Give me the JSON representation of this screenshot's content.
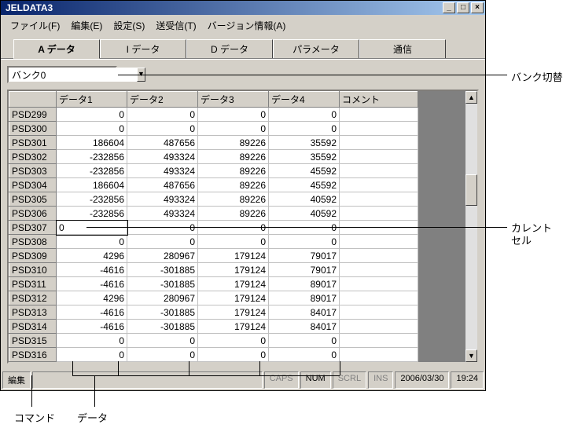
{
  "window": {
    "title": "JELDATA3"
  },
  "title_buttons": {
    "min": "_",
    "max": "□",
    "close": "×"
  },
  "menu": {
    "file": "ファイル(F)",
    "edit": "編集(E)",
    "settings": "設定(S)",
    "sendrecv": "送受信(T)",
    "version": "バージョン情報(A)"
  },
  "tabs": {
    "a": "A データ",
    "i": "I データ",
    "d": "D データ",
    "param": "パラメータ",
    "comm": "通信"
  },
  "bank": {
    "value": "バンク0"
  },
  "columns": {
    "rowhdr": "",
    "d1": "データ1",
    "d2": "データ2",
    "d3": "データ3",
    "d4": "データ4",
    "comment": "コメント"
  },
  "rows": [
    {
      "id": "PSD299",
      "d1": "0",
      "d2": "0",
      "d3": "0",
      "d4": "0"
    },
    {
      "id": "PSD300",
      "d1": "0",
      "d2": "0",
      "d3": "0",
      "d4": "0"
    },
    {
      "id": "PSD301",
      "d1": "186604",
      "d2": "487656",
      "d3": "89226",
      "d4": "35592"
    },
    {
      "id": "PSD302",
      "d1": "-232856",
      "d2": "493324",
      "d3": "89226",
      "d4": "35592"
    },
    {
      "id": "PSD303",
      "d1": "-232856",
      "d2": "493324",
      "d3": "89226",
      "d4": "45592"
    },
    {
      "id": "PSD304",
      "d1": "186604",
      "d2": "487656",
      "d3": "89226",
      "d4": "45592"
    },
    {
      "id": "PSD305",
      "d1": "-232856",
      "d2": "493324",
      "d3": "89226",
      "d4": "40592"
    },
    {
      "id": "PSD306",
      "d1": "-232856",
      "d2": "493324",
      "d3": "89226",
      "d4": "40592"
    },
    {
      "id": "PSD307",
      "d1": "0",
      "d2": "0",
      "d3": "0",
      "d4": "0",
      "current": true
    },
    {
      "id": "PSD308",
      "d1": "0",
      "d2": "0",
      "d3": "0",
      "d4": "0"
    },
    {
      "id": "PSD309",
      "d1": "4296",
      "d2": "280967",
      "d3": "179124",
      "d4": "79017"
    },
    {
      "id": "PSD310",
      "d1": "-4616",
      "d2": "-301885",
      "d3": "179124",
      "d4": "79017"
    },
    {
      "id": "PSD311",
      "d1": "-4616",
      "d2": "-301885",
      "d3": "179124",
      "d4": "89017"
    },
    {
      "id": "PSD312",
      "d1": "4296",
      "d2": "280967",
      "d3": "179124",
      "d4": "89017"
    },
    {
      "id": "PSD313",
      "d1": "-4616",
      "d2": "-301885",
      "d3": "179124",
      "d4": "84017"
    },
    {
      "id": "PSD314",
      "d1": "-4616",
      "d2": "-301885",
      "d3": "179124",
      "d4": "84017"
    },
    {
      "id": "PSD315",
      "d1": "0",
      "d2": "0",
      "d3": "0",
      "d4": "0"
    },
    {
      "id": "PSD316",
      "d1": "0",
      "d2": "0",
      "d3": "0",
      "d4": "0"
    }
  ],
  "status": {
    "mode": "編集",
    "caps": "CAPS",
    "num": "NUM",
    "scrl": "SCRL",
    "ins": "INS",
    "date": "2006/03/30",
    "time": "19:24"
  },
  "callouts": {
    "bank": "バンク切替",
    "current1": "カレント",
    "current2": "セル",
    "cmd": "コマンド",
    "data": "データ"
  },
  "scroll": {
    "up": "▲",
    "down": "▼",
    "drop": "▼"
  }
}
